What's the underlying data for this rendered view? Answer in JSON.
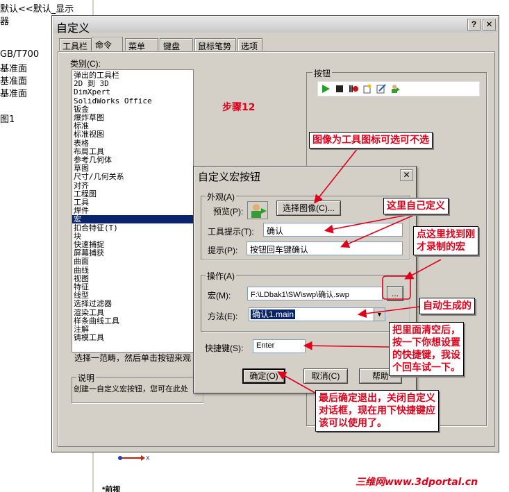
{
  "background": {
    "tree_lines": [
      "默认<<默认_显示",
      "器",
      "GB/T700",
      "基准面",
      "基准面",
      "基准面",
      "图1"
    ],
    "bottom_label": "*前视"
  },
  "customize_dialog": {
    "title": "自定义",
    "tabs": [
      "工具栏",
      "命令",
      "菜单",
      "键盘",
      "鼠标笔势",
      "选项"
    ],
    "category_label": "类别(C):",
    "categories": [
      "弹出的工具栏",
      "2D 到 3D",
      "DimXpert",
      "SolidWorks Office",
      "钣金",
      "爆炸草图",
      "标准",
      "标准视图",
      "表格",
      "布局工具",
      "参考几何体",
      "草图",
      "尺寸/几何关系",
      "对齐",
      "工程图",
      "工具",
      "焊件",
      "宏",
      "扣合特征(T)",
      "块",
      "快速捕捉",
      "屏幕捕获",
      "曲面",
      "曲线",
      "视图",
      "特征",
      "线型",
      "选择过滤器",
      "渲染工具",
      "样条曲线工具",
      "注解",
      "铸模工具"
    ],
    "selected_category": "宏",
    "buttons_label": "按钮",
    "select_hint": "选择一范畴，然后单击按钮来观",
    "explanation_label": "说明",
    "explanation_text": "创建一自定义宏按钮，您可在此处"
  },
  "macro_dialog": {
    "title": "自定义宏按钮",
    "appearance_label": "外观(A)",
    "preview_label": "预览(P):",
    "select_image_button": "选择图像(C)...",
    "tooltip_label": "工具提示(T):",
    "tooltip_value": "确认",
    "prompt_label": "提示(P):",
    "prompt_value": "按钮回车键确认",
    "action_label": "操作(A)",
    "macro_label": "宏(M):",
    "macro_value": "F:\\LDbak1\\SW\\swp\\确认.swp",
    "browse_button": "...",
    "method_label": "方法(E):",
    "method_value": "确认1.main",
    "shortcut_label": "快捷键(S):",
    "shortcut_value": "Enter",
    "ok_button": "确定(O)",
    "cancel_button": "取消(C)",
    "help_button": "帮助"
  },
  "annotations": {
    "step": "步骤12",
    "image_note": "图像为工具图标可选可不选",
    "define_note": "这里自己定义",
    "find_macro_note": [
      "点这里找到刚",
      "才录制的宏"
    ],
    "auto_note": "自动生成的",
    "shortcut_note": [
      "把里面清空后，",
      "按一下你想设置",
      "的快捷键，我设",
      "个回车试一下。"
    ],
    "final_note": [
      "最后确定退出，关闭自定义",
      "对话框，现在用下快捷键应",
      "该可以使用了。"
    ],
    "watermark": "三维网www.3dportal.cn"
  },
  "colors": {
    "annotation_red": "#e0001a",
    "selection_blue": "#0a246a",
    "dialog_gray": "#d4d0c8"
  }
}
